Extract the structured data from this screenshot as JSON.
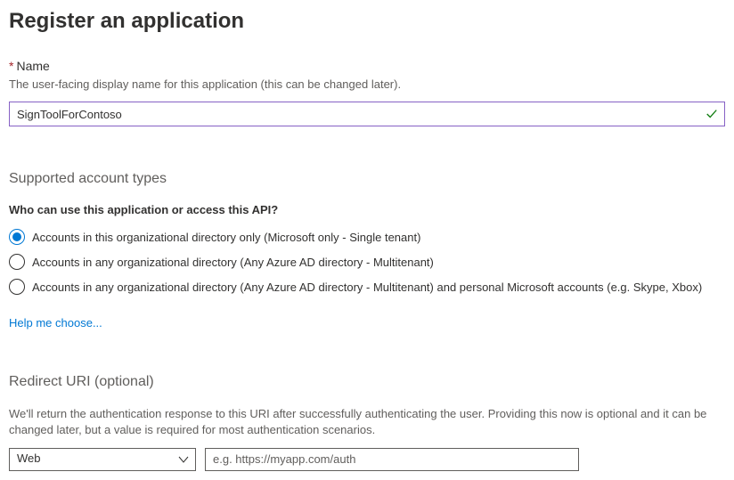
{
  "page": {
    "title": "Register an application"
  },
  "name_field": {
    "label": "Name",
    "description": "The user-facing display name for this application (this can be changed later).",
    "value": "SignToolForContoso",
    "valid": true
  },
  "account_types": {
    "heading": "Supported account types",
    "question": "Who can use this application or access this API?",
    "options": [
      {
        "label": "Accounts in this organizational directory only (Microsoft only - Single tenant)",
        "selected": true
      },
      {
        "label": "Accounts in any organizational directory (Any Azure AD directory - Multitenant)",
        "selected": false
      },
      {
        "label": "Accounts in any organizational directory (Any Azure AD directory - Multitenant) and personal Microsoft accounts (e.g. Skype, Xbox)",
        "selected": false
      }
    ],
    "help_link": "Help me choose..."
  },
  "redirect_uri": {
    "heading": "Redirect URI (optional)",
    "description": "We'll return the authentication response to this URI after successfully authenticating the user. Providing this now is optional and it can be changed later, but a value is required for most authentication scenarios.",
    "platform_value": "Web",
    "uri_placeholder": "e.g. https://myapp.com/auth",
    "uri_value": ""
  }
}
